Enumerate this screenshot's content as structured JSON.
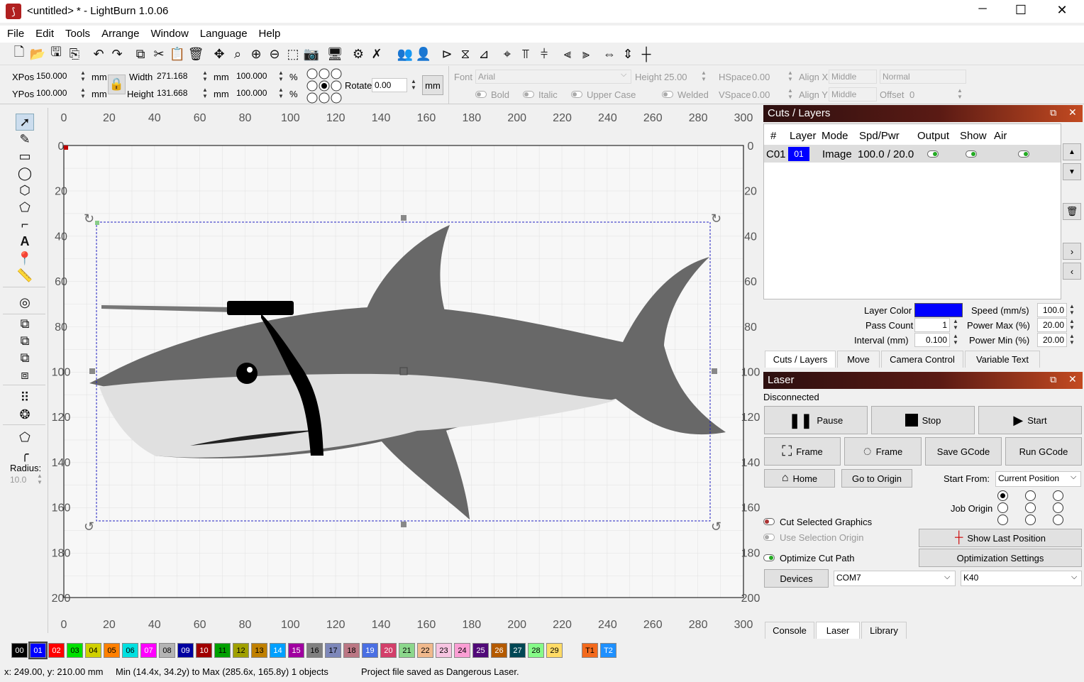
{
  "window": {
    "title": "<untitled> * - LightBurn 1.0.06",
    "minimize": "─",
    "maximize": "☐",
    "close": "✕"
  },
  "menu": [
    "File",
    "Edit",
    "Tools",
    "Arrange",
    "Window",
    "Language",
    "Help"
  ],
  "toolbar_icons": [
    "new-file",
    "open",
    "save",
    "export",
    "undo",
    "redo",
    "copy",
    "cut",
    "paste",
    "delete",
    "move",
    "zoom-fit",
    "zoom-in",
    "zoom-out",
    "zoom-window",
    "camera",
    "monitor",
    "settings",
    "tools",
    "group",
    "user",
    "mirror-h",
    "mirror-v",
    "mirror-3",
    "center",
    "align1",
    "align2",
    "align3",
    "align4",
    "distribute",
    "align-center"
  ],
  "props": {
    "xpos_label": "XPos",
    "xpos": "150.000",
    "ypos_label": "YPos",
    "ypos": "100.000",
    "unit": "mm",
    "width_label": "Width",
    "width": "271.168",
    "height_label": "Height",
    "height": "131.668",
    "scale_w": "100.000",
    "scale_h": "100.000",
    "pct": "%",
    "rotate_label": "Rotate",
    "rotate": "0.00",
    "rotate_unit_btn": "mm",
    "font_label": "Font",
    "font": "Arial",
    "font_height_label": "Height",
    "font_height": "25.00",
    "hspace_label": "HSpace",
    "hspace": "0.00",
    "vspace_label": "VSpace",
    "vspace": "0.00",
    "alignx_label": "Align X",
    "alignx": "Middle",
    "aligny_label": "Align Y",
    "aligny": "Middle",
    "normal": "Normal",
    "offset_label": "Offset",
    "offset": "0",
    "bold": "Bold",
    "italic": "Italic",
    "upper": "Upper Case",
    "welded": "Welded"
  },
  "lefttools": {
    "radius_label": "Radius:",
    "radius": "10.0"
  },
  "ruler": {
    "x": [
      "0",
      "20",
      "40",
      "60",
      "80",
      "100",
      "120",
      "140",
      "160",
      "180",
      "200",
      "220",
      "240",
      "260",
      "280",
      "300"
    ],
    "y": [
      "0",
      "20",
      "40",
      "60",
      "80",
      "100",
      "120",
      "140",
      "160",
      "180",
      "200"
    ]
  },
  "cuts": {
    "title": "Cuts / Layers",
    "cols": [
      "#",
      "Layer",
      "Mode",
      "Spd/Pwr",
      "Output",
      "Show",
      "Air"
    ],
    "row": {
      "num": "C01",
      "layer": "01",
      "mode": "Image",
      "spdpwr": "100.0 / 20.0"
    },
    "layer_color_label": "Layer Color",
    "layer_color": "#0000ff",
    "speed_label": "Speed (mm/s)",
    "speed": "100.0",
    "pass_label": "Pass Count",
    "pass": "1",
    "pmax_label": "Power Max (%)",
    "pmax": "20.00",
    "interval_label": "Interval (mm)",
    "interval": "0.100",
    "pmin_label": "Power Min (%)",
    "pmin": "20.00",
    "tabs": [
      "Cuts / Layers",
      "Move",
      "Camera Control",
      "Variable Text"
    ]
  },
  "laser": {
    "title": "Laser",
    "status": "Disconnected",
    "pause": "Pause",
    "stop": "Stop",
    "start": "Start",
    "frame1": "Frame",
    "frame2": "Frame",
    "save_gcode": "Save GCode",
    "run_gcode": "Run GCode",
    "home": "Home",
    "go_origin": "Go to Origin",
    "start_from_label": "Start From:",
    "start_from": "Current Position",
    "job_origin_label": "Job Origin",
    "cut_selected": "Cut Selected Graphics",
    "use_selection": "Use Selection Origin",
    "optimize": "Optimize Cut Path",
    "show_last": "Show Last Position",
    "opt_settings": "Optimization Settings",
    "devices": "Devices",
    "port": "COM7",
    "device": "K40",
    "tabs": [
      "Console",
      "Laser",
      "Library"
    ]
  },
  "palette": [
    {
      "id": "00",
      "color": "#000000",
      "text": "#ffffff"
    },
    {
      "id": "01",
      "color": "#0000ff",
      "text": "#ffffff"
    },
    {
      "id": "02",
      "color": "#ff0000",
      "text": "#ffffff"
    },
    {
      "id": "03",
      "color": "#00e000",
      "text": "#000000"
    },
    {
      "id": "04",
      "color": "#d0d000",
      "text": "#000000"
    },
    {
      "id": "05",
      "color": "#ff8000",
      "text": "#000000"
    },
    {
      "id": "06",
      "color": "#00e0e0",
      "text": "#000000"
    },
    {
      "id": "07",
      "color": "#ff00ff",
      "text": "#ffffff"
    },
    {
      "id": "08",
      "color": "#b4b4b4",
      "text": "#000000"
    },
    {
      "id": "09",
      "color": "#0000a0",
      "text": "#ffffff"
    },
    {
      "id": "10",
      "color": "#a00000",
      "text": "#ffffff"
    },
    {
      "id": "11",
      "color": "#00a000",
      "text": "#000000"
    },
    {
      "id": "12",
      "color": "#a0a000",
      "text": "#000000"
    },
    {
      "id": "13",
      "color": "#c08000",
      "text": "#000000"
    },
    {
      "id": "14",
      "color": "#00a0ff",
      "text": "#ffffff"
    },
    {
      "id": "15",
      "color": "#a000a0",
      "text": "#ffffff"
    },
    {
      "id": "16",
      "color": "#808080",
      "text": "#000000"
    },
    {
      "id": "17",
      "color": "#7d87b9",
      "text": "#000000"
    },
    {
      "id": "18",
      "color": "#bb7784",
      "text": "#000000"
    },
    {
      "id": "19",
      "color": "#4a6fe3",
      "text": "#ffffff"
    },
    {
      "id": "20",
      "color": "#d33f6a",
      "text": "#ffffff"
    },
    {
      "id": "21",
      "color": "#8cd78c",
      "text": "#000000"
    },
    {
      "id": "22",
      "color": "#f0b98d",
      "text": "#000000"
    },
    {
      "id": "23",
      "color": "#f6c4e1",
      "text": "#000000"
    },
    {
      "id": "24",
      "color": "#fa9ed4",
      "text": "#000000"
    },
    {
      "id": "25",
      "color": "#500a78",
      "text": "#ffffff"
    },
    {
      "id": "26",
      "color": "#b45a00",
      "text": "#ffffff"
    },
    {
      "id": "27",
      "color": "#004754",
      "text": "#ffffff"
    },
    {
      "id": "28",
      "color": "#86fa88",
      "text": "#000000"
    },
    {
      "id": "29",
      "color": "#ffdb66",
      "text": "#000000"
    },
    {
      "id": "T1",
      "color": "#f36a1d",
      "text": "#000000"
    },
    {
      "id": "T2",
      "color": "#1e90ff",
      "text": "#ffffff"
    }
  ],
  "status": {
    "coords": "x: 249.00, y: 210.00 mm",
    "bounds": "Min (14.4x, 34.2y) to Max (285.6x, 165.8y)  1 objects",
    "message": "Project file saved as Dangerous Laser."
  }
}
